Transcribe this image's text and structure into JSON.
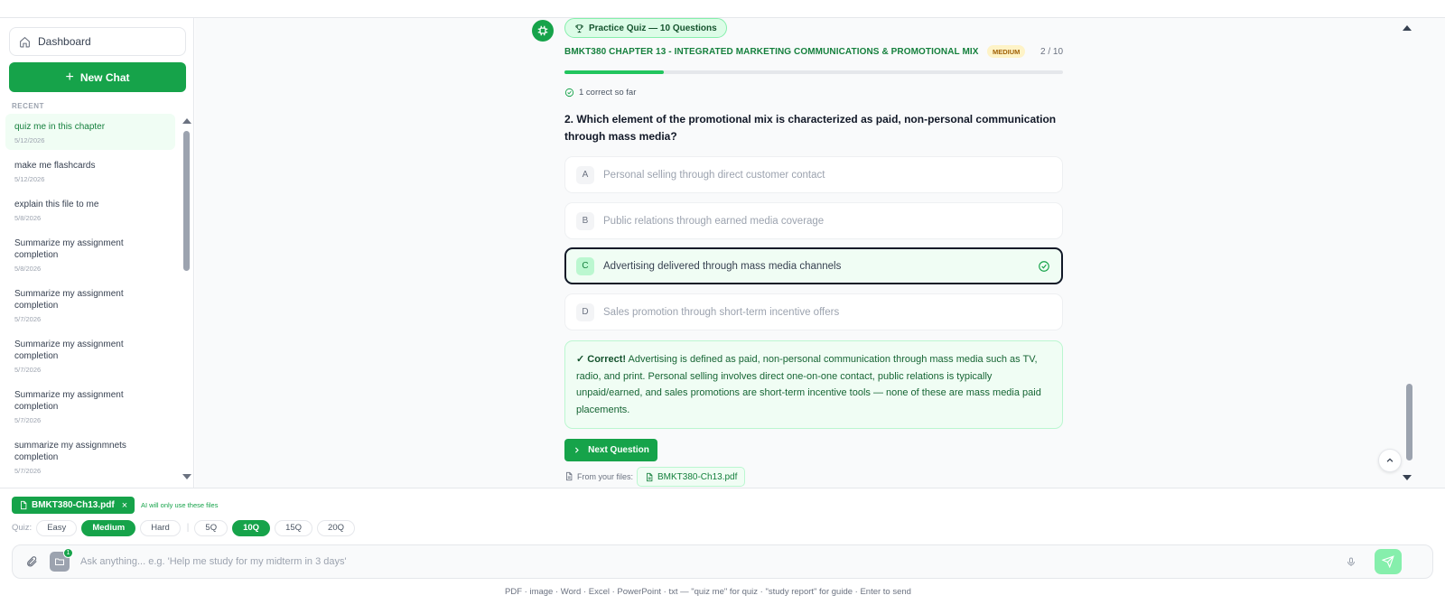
{
  "sidebar": {
    "dashboard_label": "Dashboard",
    "new_chat_label": "New Chat",
    "recent_label": "RECENT",
    "chats": [
      {
        "title": "quiz me in this chapter",
        "date": "5/12/2026",
        "active": true
      },
      {
        "title": "make me flashcards",
        "date": "5/12/2026"
      },
      {
        "title": "explain this file to me",
        "date": "5/8/2026"
      },
      {
        "title": "Summarize my assignment completion",
        "date": "5/8/2026"
      },
      {
        "title": "Summarize my assignment completion",
        "date": "5/7/2026"
      },
      {
        "title": "Summarize my assignment completion",
        "date": "5/7/2026"
      },
      {
        "title": "Summarize my assignment completion",
        "date": "5/7/2026"
      },
      {
        "title": "summarize my assignmnets completion",
        "date": "5/7/2026"
      }
    ]
  },
  "quiz": {
    "pill_label": "Practice Quiz — 10 Questions",
    "chapter_title": "BMKT380 CHAPTER 13 - INTEGRATED MARKETING COMMUNICATIONS & PROMOTIONAL MIX",
    "difficulty": "MEDIUM",
    "counter": "2 / 10",
    "progress_fraction": 0.2,
    "correct_so_far": "1 correct so far",
    "question": "2. Which element of the promotional mix is characterized as paid, non-personal communication through mass media?",
    "options": [
      {
        "letter": "A",
        "text": "Personal selling through direct customer contact"
      },
      {
        "letter": "B",
        "text": "Public relations through earned media coverage"
      },
      {
        "letter": "C",
        "text": "Advertising delivered through mass media channels",
        "selected": true
      },
      {
        "letter": "D",
        "text": "Sales promotion through short-term incentive offers"
      }
    ],
    "feedback_label": "✓ Correct!",
    "feedback_text": "Advertising is defined as paid, non-personal communication through mass media such as TV, radio, and print. Personal selling involves direct one-on-one contact, public relations is typically unpaid/earned, and sales promotions are short-term incentive tools — none of these are mass media paid placements.",
    "next_label": "Next Question",
    "from_files_label": "From your files:",
    "source_file": "BMKT380-Ch13.pdf"
  },
  "composer": {
    "attached_file": "BMKT380-Ch13.pdf",
    "attached_remove": "×",
    "ai_note": "AI will only use these files",
    "quiz_label": "Quiz:",
    "difficulty_options": [
      {
        "label": "Easy"
      },
      {
        "label": "Medium",
        "on": true
      },
      {
        "label": "Hard"
      }
    ],
    "separator": "|",
    "count_options": [
      {
        "label": "5Q"
      },
      {
        "label": "10Q",
        "on": true
      },
      {
        "label": "15Q"
      },
      {
        "label": "20Q"
      }
    ],
    "files_badge": "1",
    "placeholder": "Ask anything... e.g. 'Help me study for my midterm in 3 days'",
    "footer_hint": "PDF · image · Word · Excel · PowerPoint · txt — \"quiz me\" for quiz · \"study report\" for guide · Enter to send"
  },
  "colors": {
    "accent": "#16a34a",
    "accent_light": "#f0fdf4",
    "badge_bg": "#fef3c7"
  },
  "icons": [
    "home-icon",
    "plus-icon",
    "trophy-icon",
    "check-circle-icon",
    "chevron-right-icon",
    "file-icon",
    "paperclip-icon",
    "folder-icon",
    "mic-icon",
    "send-icon",
    "chevron-up-icon",
    "bot-icon"
  ]
}
